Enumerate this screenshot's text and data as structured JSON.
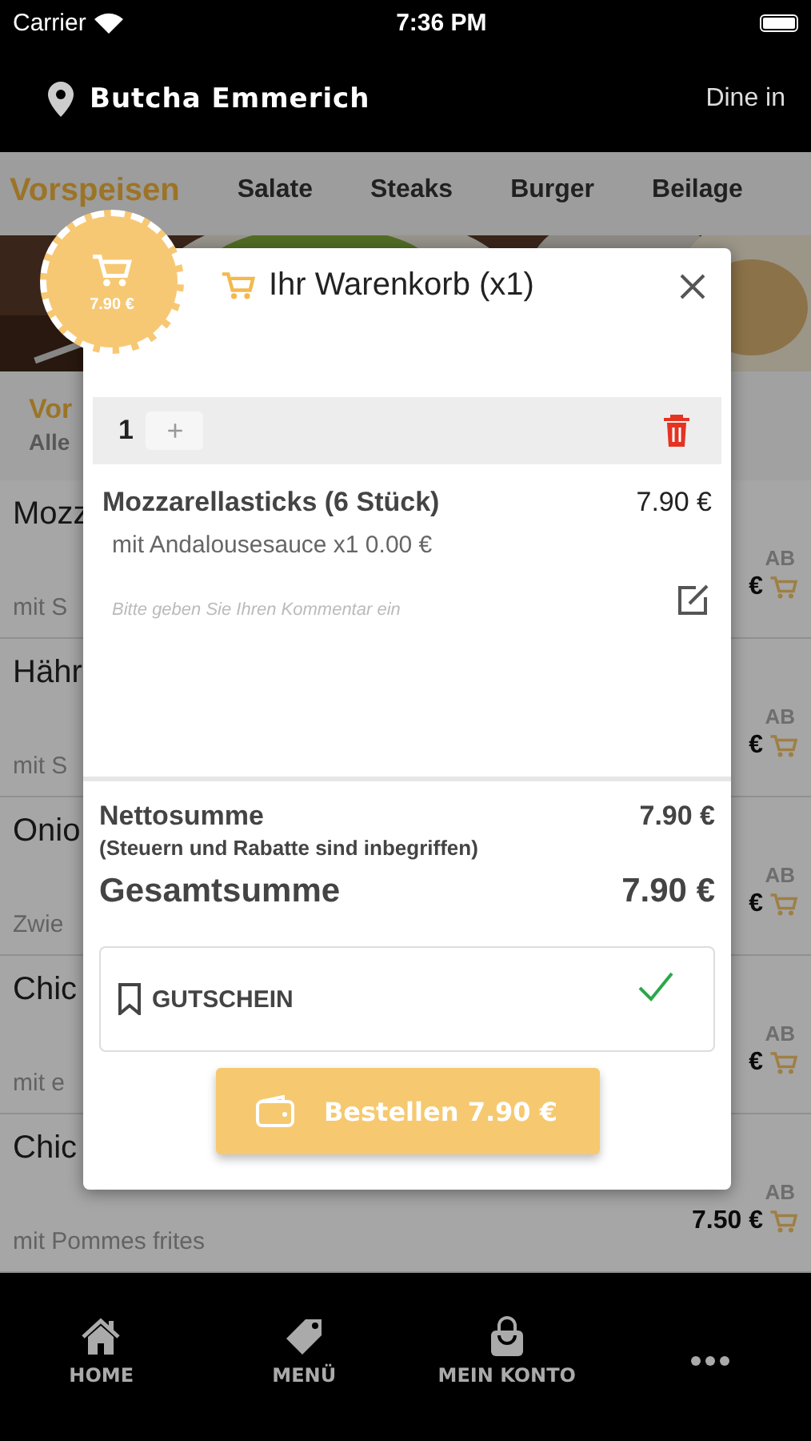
{
  "status_bar": {
    "carrier": "Carrier",
    "time": "7:36 PM"
  },
  "header": {
    "restaurant": "Butcha Emmerich",
    "mode": "Dine in"
  },
  "category_tabs": [
    {
      "label": "Vorspeisen",
      "selected": true
    },
    {
      "label": "Salate",
      "selected": false
    },
    {
      "label": "Steaks",
      "selected": false
    },
    {
      "label": "Burger",
      "selected": false
    },
    {
      "label": "Beilage",
      "selected": false
    }
  ],
  "category": {
    "title": "Vor",
    "subtitle": "Alle"
  },
  "products": [
    {
      "name": "Mozz",
      "description": "mit S",
      "from": "AB",
      "price": "€"
    },
    {
      "name": "Hähr",
      "description": "mit S",
      "from": "AB",
      "price": "€"
    },
    {
      "name": "Onio",
      "description": "Zwie",
      "from": "AB",
      "price": "€"
    },
    {
      "name": "Chic",
      "description": "mit e",
      "from": "AB",
      "price": "€"
    },
    {
      "name": "Chic",
      "description": "mit Pommes frites",
      "from": "AB",
      "price": "7.50 €"
    }
  ],
  "cart_badge": {
    "total": "7.90 €"
  },
  "cart": {
    "title": "Ihr Warenkorb (x1)",
    "items": [
      {
        "quantity": "1",
        "plus": "+",
        "name": "Mozzarellasticks (6 Stück)",
        "price": "7.90 €",
        "option": "mit Andalousesauce x1 0.00 €",
        "comment_placeholder": "Bitte geben Sie Ihren Kommentar ein"
      }
    ],
    "net_label": "Nettosumme",
    "net_value": "7.90 €",
    "net_note": "(Steuern und Rabatte sind inbegriffen)",
    "total_label": "Gesamtsumme",
    "total_value": "7.90 €",
    "voucher": {
      "label": "GUTSCHEIN",
      "checked": true
    },
    "order_button": "Bestellen 7.90 €"
  },
  "bottom_nav": [
    {
      "kind": "home",
      "label": "HOME"
    },
    {
      "kind": "tag",
      "label": "MENÜ"
    },
    {
      "kind": "bag",
      "label": "MEIN KONTO"
    },
    {
      "kind": "more"
    }
  ]
}
